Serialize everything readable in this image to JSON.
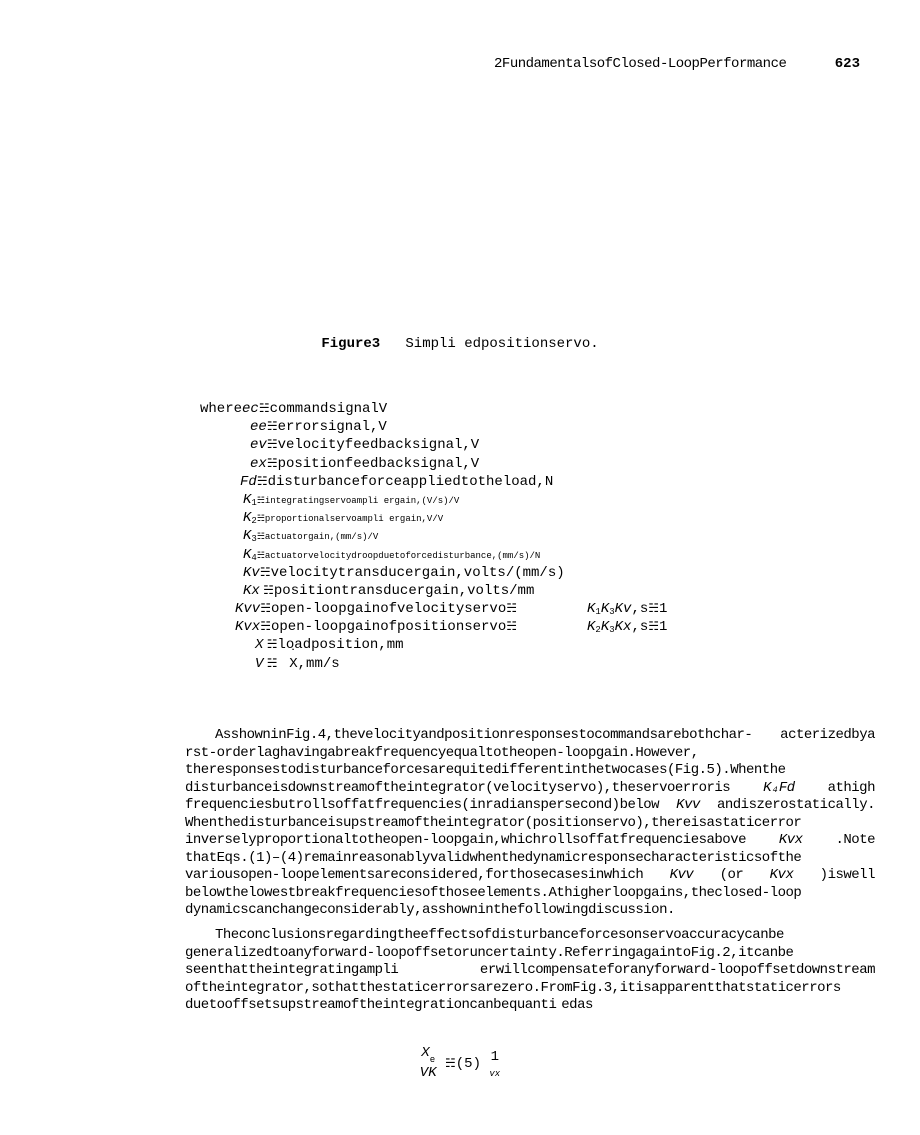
{
  "header": {
    "section": "2FundamentalsofClosed-LoopPerformance",
    "page": "623"
  },
  "figure": {
    "label": "Figure3",
    "caption": "Simpli edpositionservo."
  },
  "where": {
    "lead": "where ",
    "rows": [
      {
        "sym": "ec",
        "def": "commandsignalV"
      },
      {
        "sym": "ee",
        "def": "errorsignal,V"
      },
      {
        "sym": "ev",
        "def": "velocityfeedbacksignal,V"
      },
      {
        "sym": "ex",
        "def": "positionfeedbacksignal,V"
      },
      {
        "sym": "Fd ",
        "def": "disturbanceforceappliedtotheload,N"
      }
    ],
    "krows": [
      {
        "sub": "1",
        "def": "integratingservoampli ergain,(V/s)/V"
      },
      {
        "sub": "2",
        "def": "proportionalservoampli ergain,V/V"
      },
      {
        "sub": "3",
        "def": "actuatorgain,(mm/s)/V"
      },
      {
        "sub": "4",
        "def": "actuatorvelocitydroopduetoforcedisturbance,(mm/s)/N"
      }
    ],
    "kvrow": {
      "sym": "Kv",
      "def": "velocitytransducergain,volts/(mm/s)"
    },
    "kxrow": {
      "sym": "Kx",
      "def": "positiontransducergain,volts/mm"
    },
    "kvvrow": {
      "sym": "Kvv",
      "def": "open-loopgainofvelocityservo",
      "rhs_a": "K",
      "rhs_b": "K",
      "rhs_c": "Kv",
      "unit": ",s",
      "exp": "1",
      "s1": "1",
      "s2": "3"
    },
    "kvxrow": {
      "sym": "Kvx",
      "def": "open-loopgainofpositionservo",
      "rhs_a": "K",
      "rhs_b": "K",
      "rhs_c": "Kx",
      "unit": ",s",
      "exp": "1",
      "s1": "2",
      "s2": "3"
    },
    "xrow": {
      "sym": "X",
      "def": "loadposition,mm"
    },
    "vrow": {
      "sym": "V",
      "def": "X,mm/s",
      "dot": "˙"
    }
  },
  "para1": "AsshowninFig.4,thevelocityandpositionresponsestocommandsarebothchar- acterizedbya rst-orderlaghavingabreakfrequencyequaltotheopen-loopgain.However, theresponsestodisturbanceforcesarequitedifferentinthetwocases(Fig.5).Whenthe disturbanceisdownstreamoftheintegrator(velocityservo),theservoerroris",
  "para1_k4fd": "K₄Fd ",
  "para1_b": "athigh frequenciesbutrollsoffatfrequencies(inradianspersecond)below",
  "para1_kvv": "Kvv",
  "para1_c": "andiszerostatically. Whenthedisturbanceisupstreamoftheintegrator(positionservo),thereisastaticerror inverselyproportionaltotheopen-loopgain,whichrollsoffatfrequenciesabove ",
  "para1_kvx": "Kvx",
  "para1_d": ".Note thatEqs.(1)–(4)remainreasonablyvalidwhenthedynamicresponsecharacteristicsofthe variousopen-loopelementsareconsidered,forthosecasesinwhich ",
  "para1_kvv2": "Kvv ",
  "para1_or": "(or",
  "para1_kvx2": "Kvx",
  "para1_e": ")iswell belowthelowestbreakfrequenciesofthoseelements.Athigherloopgains,theclosed-loop dynamicscanchangeconsiderably,asshowninthefollowingdiscussion.",
  "para2": "Theconclusionsregardingtheeffectsofdisturbanceforcesonservoaccuracycanbe generalizedtoanyforward-loopoffsetoruncertainty.ReferringagaintoFig.2,itcanbe seenthattheintegratingampli erwillcompensateforanyforward-loopoffsetdownstream oftheintegrator,sothatthestaticerrorsarezero.FromFig.3,itisapparentthatstaticerrors duetooffsetsupstreamoftheintegrationcanbequanti edas",
  "eq": {
    "num_a": "X",
    "num_sub": "e",
    "den_a": "V",
    "den_b": "K",
    "rhs_num": "1",
    "rhs_sub": "vx",
    "label": "(5)"
  }
}
